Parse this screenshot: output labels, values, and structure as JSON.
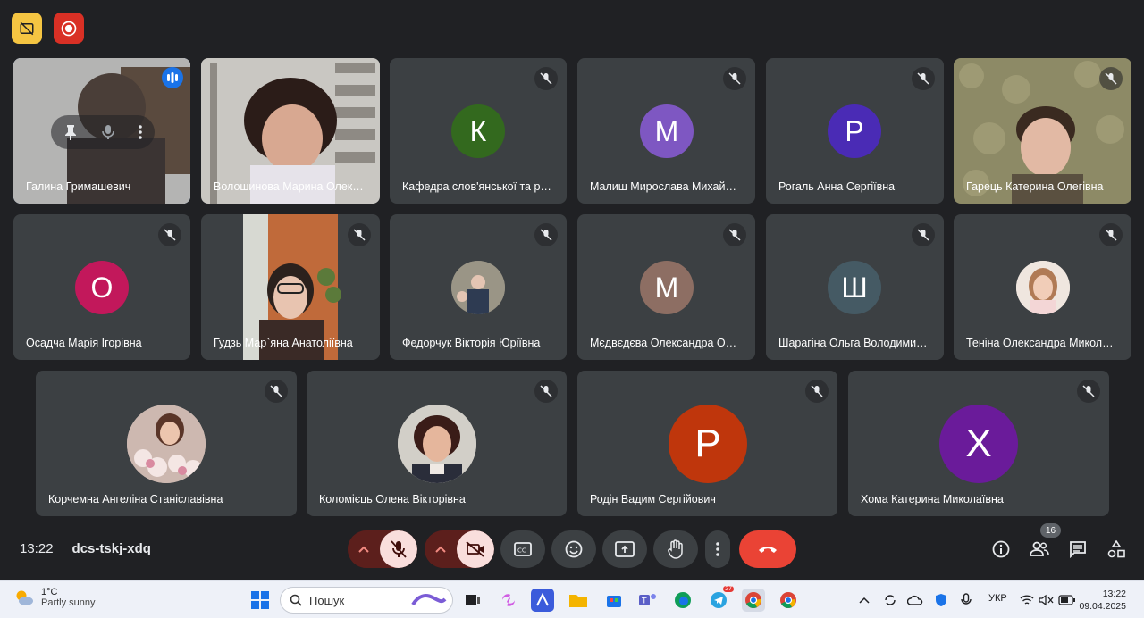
{
  "top_buttons": {
    "caption_off": "captions-off",
    "record": "recording"
  },
  "participants": [
    {
      "name": "Галина Гримашевич",
      "kind": "video",
      "active": true
    },
    {
      "name": "Волошинова Марина Олек…",
      "kind": "video"
    },
    {
      "name": "Кафедра слов'янської та р…",
      "kind": "avatar",
      "initial": "К",
      "color": "#33691e",
      "muted": true
    },
    {
      "name": "Малиш Мирослава Михай…",
      "kind": "avatar",
      "initial": "М",
      "color": "#7e57c2",
      "muted": true
    },
    {
      "name": "Рогаль Анна Сергіївна",
      "kind": "avatar",
      "initial": "Р",
      "color": "#4a2bb5",
      "muted": true
    },
    {
      "name": "Гарець Катерина Олегівна",
      "kind": "video",
      "muted": true
    },
    {
      "name": "Осадча Марія Ігорівна",
      "kind": "avatar",
      "initial": "О",
      "color": "#c2185b",
      "muted": true
    },
    {
      "name": "Гудзь Мар`яна Анатоліївна",
      "kind": "video",
      "muted": true
    },
    {
      "name": "Федорчук Вікторія Юріївна",
      "kind": "photo",
      "muted": true
    },
    {
      "name": "Мєдвєдєва Олександра О…",
      "kind": "avatar",
      "initial": "М",
      "color": "#8d6e63",
      "muted": true
    },
    {
      "name": "Шарагіна Ольга Володими…",
      "kind": "avatar",
      "initial": "Ш",
      "color": "#455a64",
      "muted": true
    },
    {
      "name": "Теніна Олександра Микол…",
      "kind": "photo",
      "muted": true
    },
    {
      "name": "Корчемна Ангеліна Станіславівна",
      "kind": "photo",
      "muted": true
    },
    {
      "name": "Коломієць Олена Вікторівна",
      "kind": "photo",
      "muted": true
    },
    {
      "name": "Родін Вадим Сергійович",
      "kind": "avatar",
      "initial": "Р",
      "color": "#bf360c",
      "muted": true
    },
    {
      "name": "Хома Катерина Миколаївна",
      "kind": "avatar",
      "initial": "Х",
      "color": "#6a1b9a",
      "muted": true
    }
  ],
  "tile_controls": [
    "pin-icon",
    "mic-icon",
    "more-icon"
  ],
  "meeting": {
    "time": "13:22",
    "code": "dcs-tskj-xdq"
  },
  "people_count": "16",
  "taskbar": {
    "temperature": "1°C",
    "condition": "Partly sunny",
    "search_placeholder": "Пошук",
    "language": "УКР",
    "clock_time": "13:22",
    "clock_date": "09.04.2025",
    "telegram_badge": "27"
  },
  "colors": {
    "background": "#202124",
    "tile": "#3c4043",
    "accent": "#8ab4f8",
    "hangup": "#ea4335"
  }
}
